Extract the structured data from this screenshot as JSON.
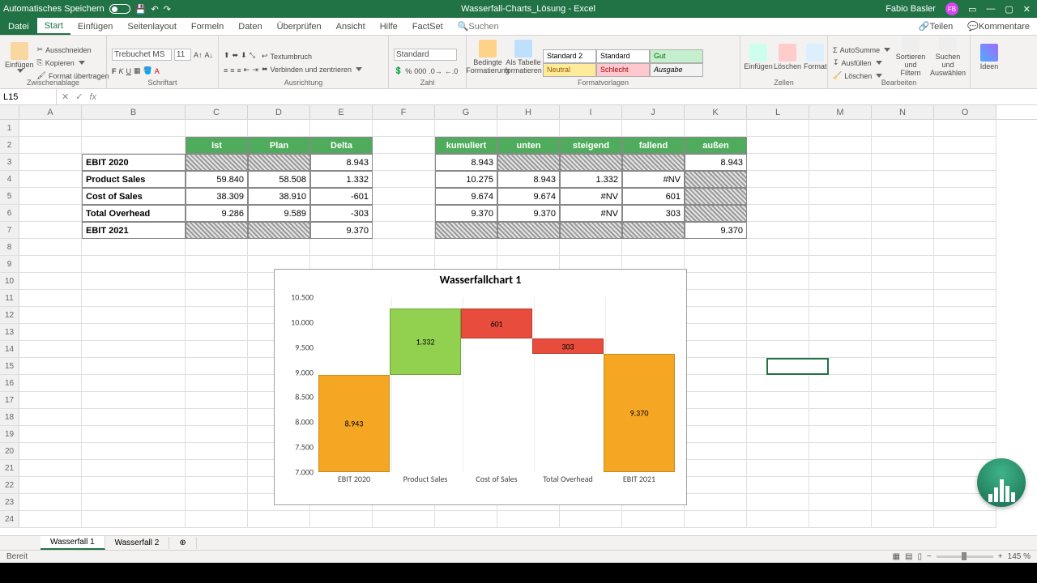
{
  "titlebar": {
    "autosave": "Automatisches Speichern",
    "docname": "Wasserfall-Charts_Lösung  -  Excel",
    "user": "Fabio Basler",
    "user_init": "FB"
  },
  "menu": {
    "file": "Datei",
    "items": [
      "Start",
      "Einfügen",
      "Seitenlayout",
      "Formeln",
      "Daten",
      "Überprüfen",
      "Ansicht",
      "Hilfe",
      "FactSet"
    ],
    "search_placeholder": "Suchen",
    "teilen": "Teilen",
    "kommentare": "Kommentare"
  },
  "ribbon": {
    "zwischenablage": "Zwischenablage",
    "einfuegen": "Einfügen",
    "ausschneiden": "Ausschneiden",
    "kopieren": "Kopieren",
    "format_uebertragen": "Format übertragen",
    "schriftart": "Schriftart",
    "font_name": "Trebuchet MS",
    "font_size": "11",
    "ausrichtung": "Ausrichtung",
    "textumbruch": "Textumbruch",
    "verbinden": "Verbinden und zentrieren",
    "zahl": "Zahl",
    "zahl_format": "Standard",
    "formatvorlagen": "Formatvorlagen",
    "bedingte": "Bedingte Formatierung",
    "tabelle": "Als Tabelle formatieren",
    "s_std2": "Standard 2",
    "s_std": "Standard",
    "s_gut": "Gut",
    "s_neutral": "Neutral",
    "s_schlecht": "Schlecht",
    "s_ausgabe": "Ausgabe",
    "zellen": "Zellen",
    "z_einfuegen": "Einfügen",
    "z_loeschen": "Löschen",
    "z_format": "Format",
    "bearbeiten": "Bearbeiten",
    "autosumme": "AutoSumme",
    "ausfuellen": "Ausfüllen",
    "loeschen": "Löschen",
    "sortieren": "Sortieren und Filtern",
    "suchen": "Suchen und Auswählen",
    "ideen": "Ideen"
  },
  "namebox": {
    "ref": "L15"
  },
  "columns": [
    "A",
    "B",
    "C",
    "D",
    "E",
    "F",
    "G",
    "H",
    "I",
    "J",
    "K",
    "L",
    "M",
    "N",
    "O"
  ],
  "table": {
    "head_ist": "Ist",
    "head_plan": "Plan",
    "head_delta": "Delta",
    "head_kum": "kumuliert",
    "head_unten": "unten",
    "head_steig": "steigend",
    "head_fall": "fallend",
    "head_aussen": "außen",
    "rows": [
      {
        "label": "EBIT 2020",
        "ist": "",
        "plan": "",
        "delta": "8.943",
        "kum": "8.943",
        "unten": "",
        "steig": "",
        "fall": "",
        "aussen": "8.943"
      },
      {
        "label": "Product Sales",
        "ist": "59.840",
        "plan": "58.508",
        "delta": "1.332",
        "kum": "10.275",
        "unten": "8.943",
        "steig": "1.332",
        "fall": "#NV",
        "aussen": ""
      },
      {
        "label": "Cost of Sales",
        "ist": "38.309",
        "plan": "38.910",
        "delta": "-601",
        "kum": "9.674",
        "unten": "9.674",
        "steig": "#NV",
        "fall": "601",
        "aussen": ""
      },
      {
        "label": "Total Overhead",
        "ist": "9.286",
        "plan": "9.589",
        "delta": "-303",
        "kum": "9.370",
        "unten": "9.370",
        "steig": "#NV",
        "fall": "303",
        "aussen": ""
      },
      {
        "label": "EBIT 2021",
        "ist": "",
        "plan": "",
        "delta": "9.370",
        "kum": "",
        "unten": "",
        "steig": "",
        "fall": "",
        "aussen": "9.370"
      }
    ]
  },
  "chart_data": {
    "type": "bar",
    "title": "Wasserfallchart 1",
    "categories": [
      "EBIT 2020",
      "Product Sales",
      "Cost of Sales",
      "Total Overhead",
      "EBIT 2021"
    ],
    "ylim": [
      7000,
      10500
    ],
    "yticks": [
      "7.000",
      "7.500",
      "8.000",
      "8.500",
      "9.000",
      "9.500",
      "10.000",
      "10.500"
    ],
    "series": [
      {
        "name": "außen",
        "role": "pillar",
        "color": "#f5a623",
        "values": [
          8943,
          null,
          null,
          null,
          9370
        ]
      },
      {
        "name": "unten",
        "role": "invisible",
        "values": [
          null,
          8943,
          9674,
          9370,
          null
        ]
      },
      {
        "name": "steigend",
        "role": "up",
        "color": "#92d050",
        "values": [
          null,
          1332,
          null,
          null,
          null
        ]
      },
      {
        "name": "fallend",
        "role": "down",
        "color": "#e74c3c",
        "values": [
          null,
          null,
          601,
          303,
          null
        ]
      }
    ],
    "data_labels": [
      "8.943",
      "1.332",
      "601",
      "303",
      "9.370"
    ]
  },
  "sheets": {
    "tabs": [
      "Wasserfall 1",
      "Wasserfall 2"
    ],
    "active": 0
  },
  "status": {
    "ready": "Bereit",
    "zoom": "145 %"
  }
}
